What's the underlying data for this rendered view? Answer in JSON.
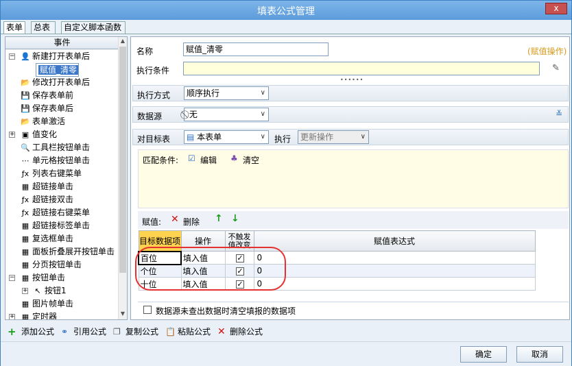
{
  "window": {
    "title": "填表公式管理",
    "close": "x"
  },
  "tabs": [
    "表单",
    "总表",
    "自定义脚本函数"
  ],
  "left": {
    "header": "事件",
    "items": [
      {
        "label": "新建打开表单后",
        "icon": "👤",
        "exp": "−"
      },
      {
        "label": "赋值_清零",
        "icon": "",
        "sel": true
      },
      {
        "label": "修改打开表单后",
        "icon": "📂"
      },
      {
        "label": "保存表单前",
        "icon": "💾"
      },
      {
        "label": "保存表单后",
        "icon": "💾"
      },
      {
        "label": "表单激活",
        "icon": "📂"
      },
      {
        "label": "值变化",
        "icon": "▣",
        "exp": "+"
      },
      {
        "label": "工具栏按钮单击",
        "icon": "🔍"
      },
      {
        "label": "单元格按钮单击",
        "icon": "⋯"
      },
      {
        "label": "列表右键菜单",
        "icon": "ƒx"
      },
      {
        "label": "超链接单击",
        "icon": "▦"
      },
      {
        "label": "超链接双击",
        "icon": "ƒx"
      },
      {
        "label": "超链接右键菜单",
        "icon": "ƒx"
      },
      {
        "label": "超链接标签单击",
        "icon": "▦"
      },
      {
        "label": "复选框单击",
        "icon": "▦"
      },
      {
        "label": "面板折叠展开按钮单击",
        "icon": "▦"
      },
      {
        "label": "分页按钮单击",
        "icon": "▦"
      },
      {
        "label": "按钮单击",
        "icon": "▦",
        "exp": "−"
      },
      {
        "label": "按钮1",
        "icon": "↖",
        "exp": "+",
        "child": true
      },
      {
        "label": "图片帧单击",
        "icon": "▦"
      },
      {
        "label": "定时器",
        "icon": "▦",
        "exp": "+"
      }
    ]
  },
  "form": {
    "name_label": "名称",
    "name_value": "赋值_清零",
    "type_badge": "(赋值操作)",
    "cond_label": "执行条件",
    "cond_value": "",
    "exec_label": "执行方式",
    "exec_value": "顺序执行",
    "ds_label": "数据源",
    "ds_value": "无",
    "target_label": "对目标表",
    "target_value": "本表单",
    "run_label": "执行",
    "run_value": "更新操作",
    "match_label": "匹配条件:",
    "edit_label": "编辑",
    "clear_label": "清空",
    "assign_label": "赋值:",
    "delete_label": "删除",
    "columns": [
      "目标数据项",
      "操作",
      "不触发值改变",
      "赋值表达式"
    ],
    "rows": [
      {
        "target": "百位",
        "op": "填入值",
        "nochange": true,
        "expr": "0"
      },
      {
        "target": "个位",
        "op": "填入值",
        "nochange": true,
        "expr": "0"
      },
      {
        "target": "十位",
        "op": "填入值",
        "nochange": true,
        "expr": "0"
      }
    ],
    "clear_check_label": "数据源未查出数据时清空填报的数据项"
  },
  "bottom": {
    "add": "添加公式",
    "ref": "引用公式",
    "copy": "复制公式",
    "paste": "粘贴公式",
    "delete": "删除公式"
  },
  "footer": {
    "ok": "确定",
    "cancel": "取消"
  }
}
